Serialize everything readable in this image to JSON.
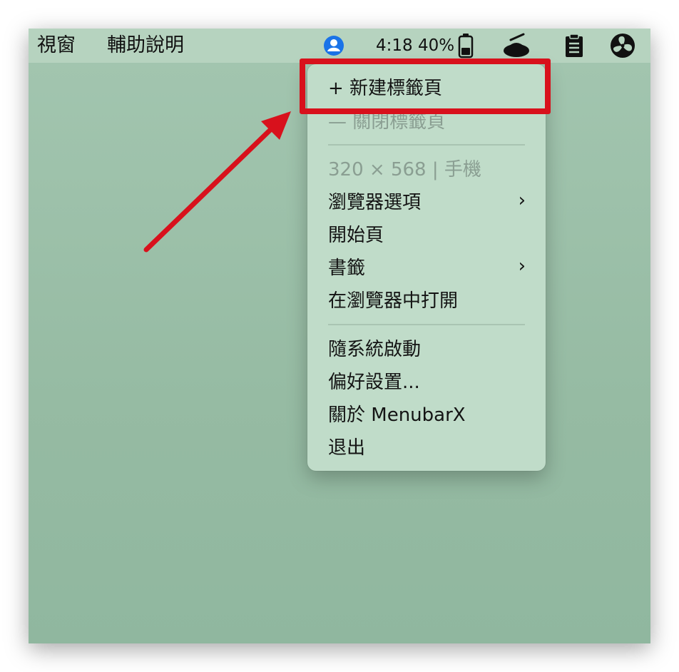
{
  "menubar": {
    "app_menus": [
      "視窗",
      "輔助說明"
    ],
    "clock_battery": "4:18 40%",
    "icons": [
      "person-icon",
      "battery-icon",
      "ufo-icon",
      "clipboard-icon",
      "fan-icon"
    ]
  },
  "menu": {
    "new_tab": "+ 新建標籤頁",
    "close_tab": "— 關閉標籤頁",
    "size_info": "320 × 568 | 手機",
    "browser_options": "瀏覽器選項",
    "start_page": "開始頁",
    "bookmarks": "書籤",
    "open_in_browser": "在瀏覽器中打開",
    "launch_at_login": "隨系統啟動",
    "preferences": "偏好設置...",
    "about": "關於 MenubarX",
    "quit": "退出",
    "chevron": "›"
  },
  "colors": {
    "highlight": "#d8111c",
    "menu_bg": "#c0dcc9",
    "menubar_bg": "#b6d3bf",
    "desktop_bg": "#9dc2aa",
    "person_icon": "#1a73e8"
  }
}
